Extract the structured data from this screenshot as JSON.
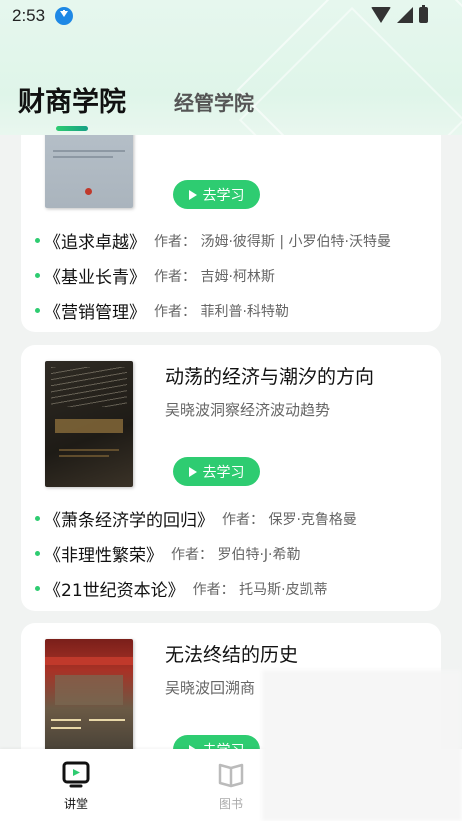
{
  "status_bar": {
    "time": "2:53"
  },
  "tabs": {
    "active": "财商学院",
    "inactive": "经管学院"
  },
  "cards": [
    {
      "button": "去学习",
      "recommendations": [
        {
          "title": "《追求卓越》",
          "author": "作者： 汤姆·彼得斯 | 小罗伯特·沃特曼"
        },
        {
          "title": "《基业长青》",
          "author": "作者： 吉姆·柯林斯"
        },
        {
          "title": "《营销管理》",
          "author": "作者： 菲利普·科特勒"
        }
      ]
    },
    {
      "title": "动荡的经济与潮汐的方向",
      "subtitle": "吴晓波洞察经济波动趋势",
      "button": "去学习",
      "recommendations": [
        {
          "title": "《萧条经济学的回归》",
          "author": "作者： 保罗·克鲁格曼"
        },
        {
          "title": "《非理性繁荣》",
          "author": "作者： 罗伯特·J·希勒"
        },
        {
          "title": "《21世纪资本论》",
          "author": "作者： 托马斯·皮凯蒂"
        }
      ]
    },
    {
      "title": "无法终结的历史",
      "subtitle": "吴晓波回溯商",
      "button": "去学习"
    }
  ],
  "bottom_nav": [
    {
      "label": "讲堂",
      "icon": "tv-icon",
      "active": true
    },
    {
      "label": "图书",
      "icon": "book-icon",
      "active": false
    }
  ],
  "colors": {
    "accent": "#2ecc71",
    "header_bg": "#e3f6eb"
  }
}
